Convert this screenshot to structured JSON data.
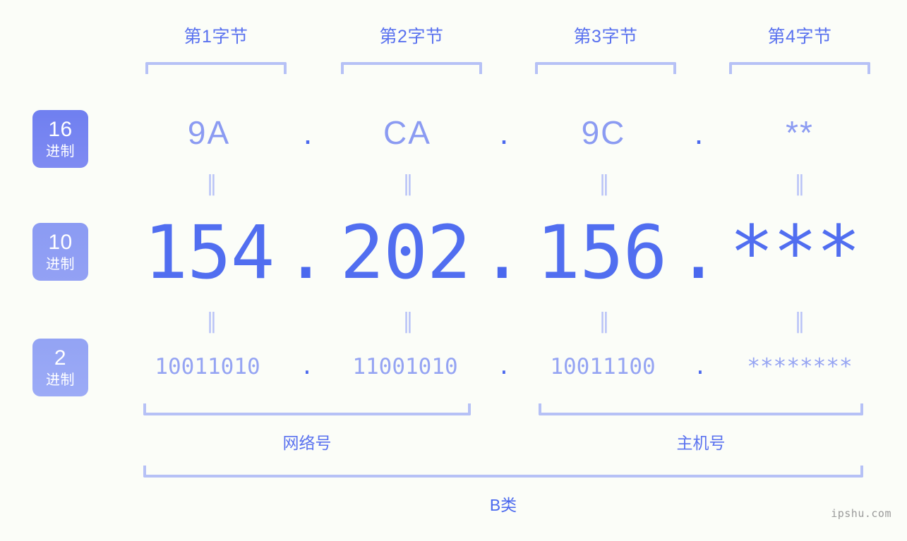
{
  "watermark": "ipshu.com",
  "colors": {
    "background": "#fbfdf8",
    "accent_strong": "#4a68ee",
    "accent_mid": "#5a72ef",
    "accent_light": "#8b9bf2",
    "bracket": "#b6c1f6",
    "badge_hex": "#6f7ff0",
    "badge_dec": "#8b9bf3",
    "badge_bin": "#93a3f4"
  },
  "byte_headers": [
    {
      "label": "第1字节"
    },
    {
      "label": "第2字节"
    },
    {
      "label": "第3字节"
    },
    {
      "label": "第4字节"
    }
  ],
  "badges": [
    {
      "num": "16",
      "unit": "进制"
    },
    {
      "num": "10",
      "unit": "进制"
    },
    {
      "num": "2",
      "unit": "进制"
    }
  ],
  "rows": {
    "hex": {
      "values": [
        "9A",
        "CA",
        "9C",
        "**"
      ],
      "separator": "."
    },
    "decimal": {
      "values": [
        "154",
        "202",
        "156",
        "***"
      ],
      "separator": "."
    },
    "binary": {
      "values": [
        "10011010",
        "11001010",
        "10011100",
        "********"
      ],
      "separator": "."
    }
  },
  "equality": {
    "symbol": "‖"
  },
  "sections": [
    {
      "label": "网络号"
    },
    {
      "label": "主机号"
    }
  ],
  "class": {
    "label": "B类"
  }
}
